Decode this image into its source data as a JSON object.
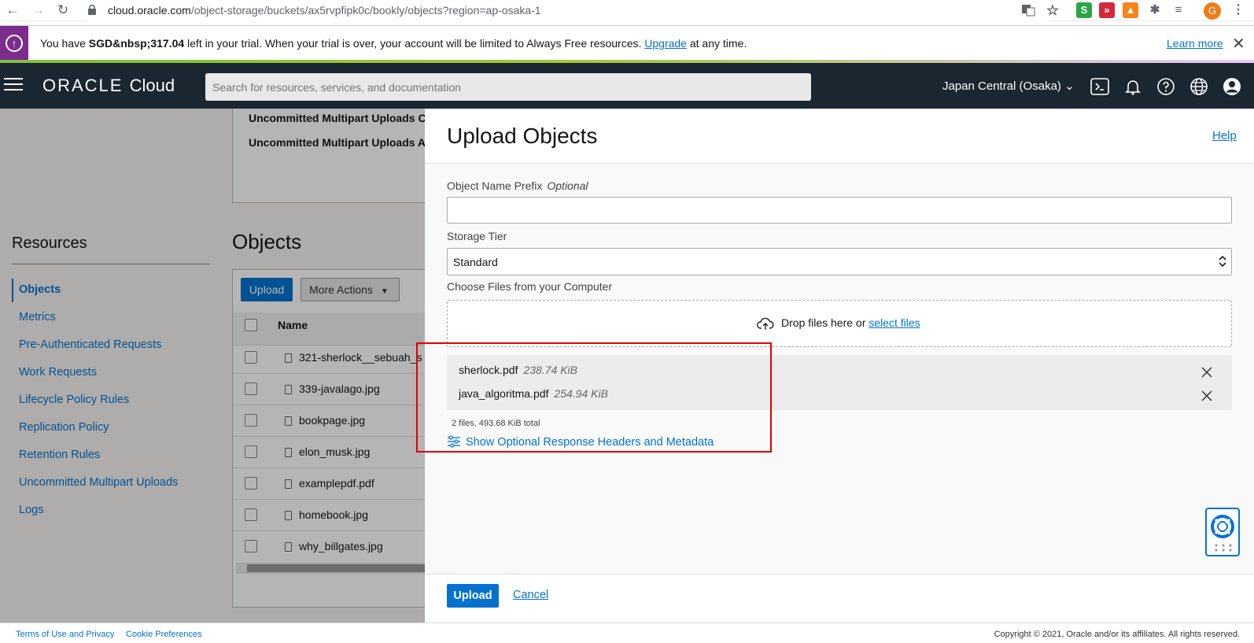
{
  "browser": {
    "url_host": "cloud.oracle.com",
    "url_path": "/object-storage/buckets/ax5rvpfipk0c/bookly/objects?region=ap-osaka-1",
    "profile_initial": "G"
  },
  "trial_banner": {
    "prefix": "You have ",
    "amount": "SGD&nbsp;317.04",
    "middle": " left in your trial. When your trial is over, your account will be limited to Always Free resources. ",
    "upgrade_link": "Upgrade",
    "suffix": " at any time.",
    "learn_more": "Learn more"
  },
  "header": {
    "logo_main": "ORACLE",
    "logo_sub": "Cloud",
    "search_placeholder": "Search for resources, services, and documentation",
    "region": "Japan Central (Osaka)"
  },
  "background_page": {
    "details_rows": [
      "Uncommitted Multipart Uploads C",
      "Uncommitted Multipart Uploads A"
    ],
    "resources_title": "Resources",
    "resources": [
      "Objects",
      "Metrics",
      "Pre-Authenticated Requests",
      "Work Requests",
      "Lifecycle Policy Rules",
      "Replication Policy",
      "Retention Rules",
      "Uncommitted Multipart Uploads",
      "Logs"
    ],
    "objects_title": "Objects",
    "upload_label": "Upload",
    "more_actions_label": "More Actions",
    "name_column": "Name",
    "files": [
      "321-sherlock__sebuah_s",
      "339-javalago.jpg",
      "bookpage.jpg",
      "elon_musk.jpg",
      "examplepdf.pdf",
      "homebook.jpg",
      "why_billgates.jpg"
    ]
  },
  "drawer": {
    "title": "Upload Objects",
    "help": "Help",
    "prefix_label": "Object Name Prefix",
    "prefix_optional": "Optional",
    "prefix_value": "",
    "storage_tier_label": "Storage Tier",
    "storage_tier_value": "Standard",
    "choose_files_label": "Choose Files from your Computer",
    "drop_text": "Drop files here or ",
    "select_files": "select files",
    "files": [
      {
        "name": "sherlock.pdf",
        "size": "238.74 KiB"
      },
      {
        "name": "java_algoritma.pdf",
        "size": "254.94 KiB"
      }
    ],
    "total": "2 files, 493.68 KiB total",
    "metadata_link": "Show Optional Response Headers and Metadata",
    "upload_button": "Upload",
    "cancel_link": "Cancel"
  },
  "footer": {
    "terms": "Terms of Use and Privacy",
    "cookies": "Cookie Preferences",
    "copyright": "Copyright © 2021, Oracle and/or its affiliates. All rights reserved."
  },
  "colors": {
    "accent": "#0572ce",
    "header_bg": "#1a2630",
    "banner_icon_bg": "#7b2c8c",
    "highlight": "#e00000"
  }
}
